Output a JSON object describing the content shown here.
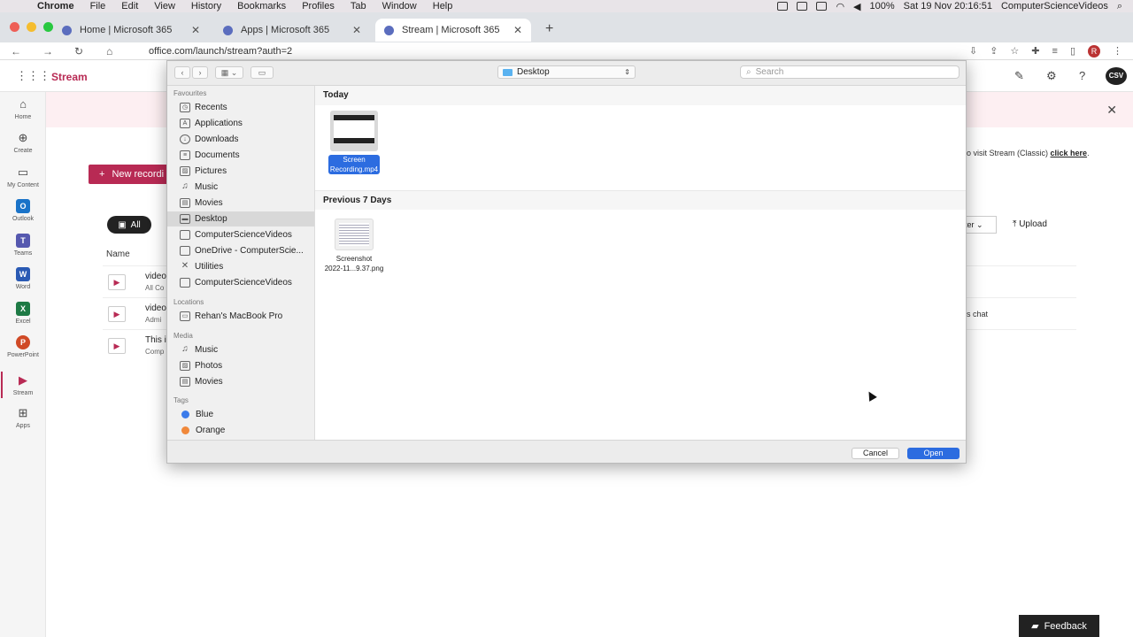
{
  "menubar": {
    "app": "Chrome",
    "items": [
      "File",
      "Edit",
      "View",
      "History",
      "Bookmarks",
      "Profiles",
      "Tab",
      "Window",
      "Help"
    ],
    "battery": "100%",
    "clock": "Sat 19 Nov  20:16:51",
    "user": "ComputerScienceVideos"
  },
  "tabs": [
    {
      "title": "Home | Microsoft 365"
    },
    {
      "title": "Apps | Microsoft 365"
    },
    {
      "title": "Stream | Microsoft 365"
    }
  ],
  "address": {
    "url": "office.com/launch/stream?auth=2",
    "profile_initial": "R"
  },
  "app": {
    "title": "Stream",
    "avatar": "CSV"
  },
  "rail": [
    "Home",
    "Create",
    "My Content",
    "Outlook",
    "Teams",
    "Word",
    "Excel",
    "PowerPoint",
    "Stream",
    "Apps"
  ],
  "page": {
    "classic_text": "o visit Stream (Classic)",
    "classic_link": "click here",
    "new_recording": "New recordi",
    "all_filter": "All",
    "name_header": "Name",
    "filter_label": "ter",
    "upload_label": "Upload",
    "rows": [
      {
        "title": "video",
        "sub": "All Co"
      },
      {
        "title": "video",
        "sub": "Admi"
      },
      {
        "title": "This i",
        "sub": "Comp"
      }
    ],
    "chat_fragment": "s chat",
    "feedback": "Feedback"
  },
  "dialog": {
    "location": "Desktop",
    "search_placeholder": "Search",
    "sidebar": {
      "favourites_label": "Favourites",
      "favourites": [
        "Recents",
        "Applications",
        "Downloads",
        "Documents",
        "Pictures",
        "Music",
        "Movies",
        "Desktop",
        "ComputerScienceVideos",
        "OneDrive - ComputerScie...",
        "Utilities",
        "ComputerScienceVideos"
      ],
      "locations_label": "Locations",
      "locations": [
        "Rehan's MacBook Pro"
      ],
      "media_label": "Media",
      "media": [
        "Music",
        "Photos",
        "Movies"
      ],
      "tags_label": "Tags",
      "tags": [
        {
          "name": "Blue",
          "color": "#3b7bea"
        },
        {
          "name": "Orange",
          "color": "#f0883a"
        }
      ]
    },
    "groups": [
      {
        "label": "Today",
        "files": [
          {
            "name_line1": "Screen",
            "name_line2": "Recording.mp4"
          }
        ]
      },
      {
        "label": "Previous 7 Days",
        "files": [
          {
            "name_line1": "Screenshot",
            "name_line2": "2022-11...9.37.png"
          }
        ]
      }
    ],
    "cancel": "Cancel",
    "open": "Open"
  }
}
